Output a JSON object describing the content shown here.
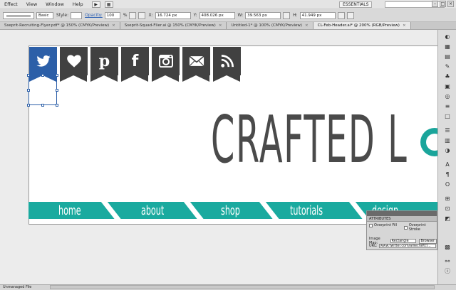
{
  "menubar": {
    "items": [
      "Effect",
      "View",
      "Window",
      "Help"
    ],
    "workspace": "ESSENTIALS"
  },
  "control": {
    "stroke_profile": "Basic",
    "style_label": "Style:",
    "opacity_label": "Opacity:",
    "opacity_value": "100",
    "opacity_unit": "%",
    "x_label": "X:",
    "x_value": "16.724 px",
    "y_label": "Y:",
    "y_value": "408.026 px",
    "w_label": "W:",
    "w_value": "39.563 px",
    "h_label": "H:",
    "h_value": "41.949 px"
  },
  "tabs": [
    {
      "label": "Sseprit-Recruiting-Flyer.pdf* @ 150% (CMYK/Preview)",
      "active": false
    },
    {
      "label": "Sseprit-Squad-Flier.ai @ 150% (CMYK/Preview)",
      "active": false
    },
    {
      "label": "Untitled-1* @ 100% (CMYK/Preview)",
      "active": false
    },
    {
      "label": "CL-Feb-Header.ai* @ 200% (RGB/Preview)",
      "active": true
    }
  ],
  "artwork": {
    "icons": [
      "twitter-icon",
      "heart-icon",
      "pinterest-icon",
      "facebook-icon",
      "instagram-icon",
      "mail-icon",
      "rss-icon"
    ],
    "headline": "CRAFTED L",
    "nav": [
      "home",
      "about",
      "shop",
      "tutorials",
      "design"
    ],
    "teal": "#1aaa9f",
    "dark": "#414141",
    "selected_blue": "#2c5fa8"
  },
  "attributes_panel": {
    "title": "ATTRIBUTES",
    "overprint_fill": "Overprint Fill",
    "overprint_stroke": "Overprint Stroke",
    "image_map_label": "Image Map:",
    "image_map_value": "Rectangle",
    "browser_button": "Browser",
    "url_label": "URL:",
    "url_value": "www.twitter.com/alliecraftcl..."
  },
  "status": {
    "text": "Unmanaged File"
  }
}
